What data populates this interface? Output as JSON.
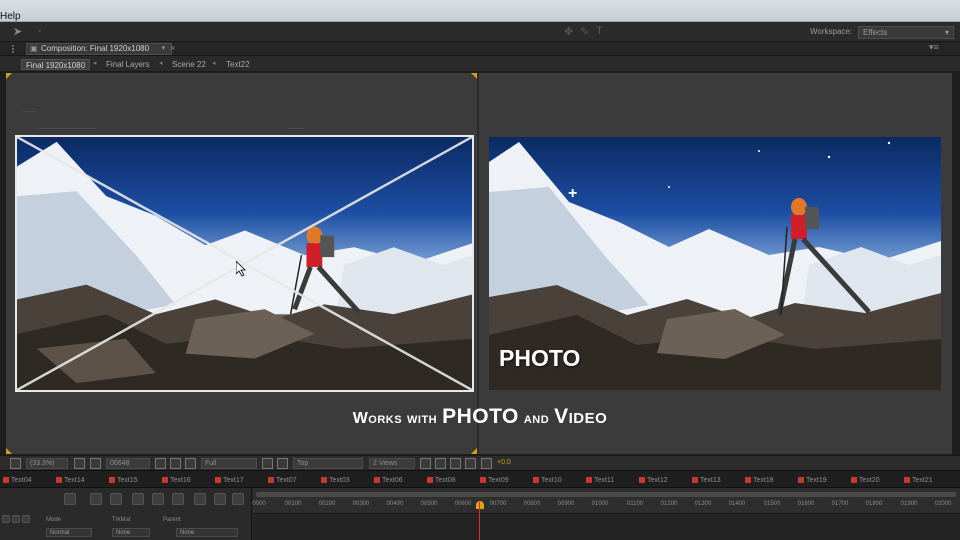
{
  "menubar": {
    "help_label": "Help"
  },
  "toolbar": {
    "icons": [
      "selection-tool-icon",
      "hand-tool-icon",
      "zoom-tool-icon",
      "rotate-tool-icon",
      "camera-tool-icon",
      "pan-behind-icon",
      "pen-tool-icon",
      "text-tool-icon"
    ],
    "workspace_label": "Workspace:",
    "workspace_value": "Effects"
  },
  "composition_panel": {
    "tab_label": "Composition: Final 1920x1080",
    "breadcrumbs": [
      "Final 1920x1080",
      "Final Layers",
      "Scene 22",
      "Text22"
    ]
  },
  "viewer": {
    "photo_label": "PHOTO",
    "caption_prefix": "Works with",
    "caption_photo": "PHOTO",
    "caption_and": "and",
    "caption_video": "Video"
  },
  "viewer_bar": {
    "zoom": "(33.3%)",
    "timecode": "00648",
    "resolution": "Full",
    "view": "Top",
    "views_count": "2 Views",
    "exposure": "+0.0"
  },
  "layer_tabs": [
    "Text04",
    "Text14",
    "Text15",
    "Text16",
    "Text17",
    "Text07",
    "Text03",
    "Text06",
    "Text08",
    "Text09",
    "Text10",
    "Text11",
    "Text12",
    "Text13",
    "Text18",
    "Text19",
    "Text20",
    "Text21"
  ],
  "timeline": {
    "ruler_ticks": [
      "0000",
      "00100",
      "00200",
      "00300",
      "00400",
      "00500",
      "00600",
      "00700",
      "00800",
      "00900",
      "01000",
      "01100",
      "01200",
      "01300",
      "01400",
      "01500",
      "01600",
      "01700",
      "01800",
      "01900",
      "02000"
    ],
    "columns": {
      "mode_label": "Mode",
      "trkmat_label": "TrkMat",
      "parent_label": "Parent",
      "mode_value": "Normal",
      "trkmat_value": "None",
      "parent_value": "None"
    }
  },
  "colors": {
    "accent_orange": "#d79a22",
    "layer_red": "#c23a2f",
    "playhead": "#d22f2f"
  }
}
